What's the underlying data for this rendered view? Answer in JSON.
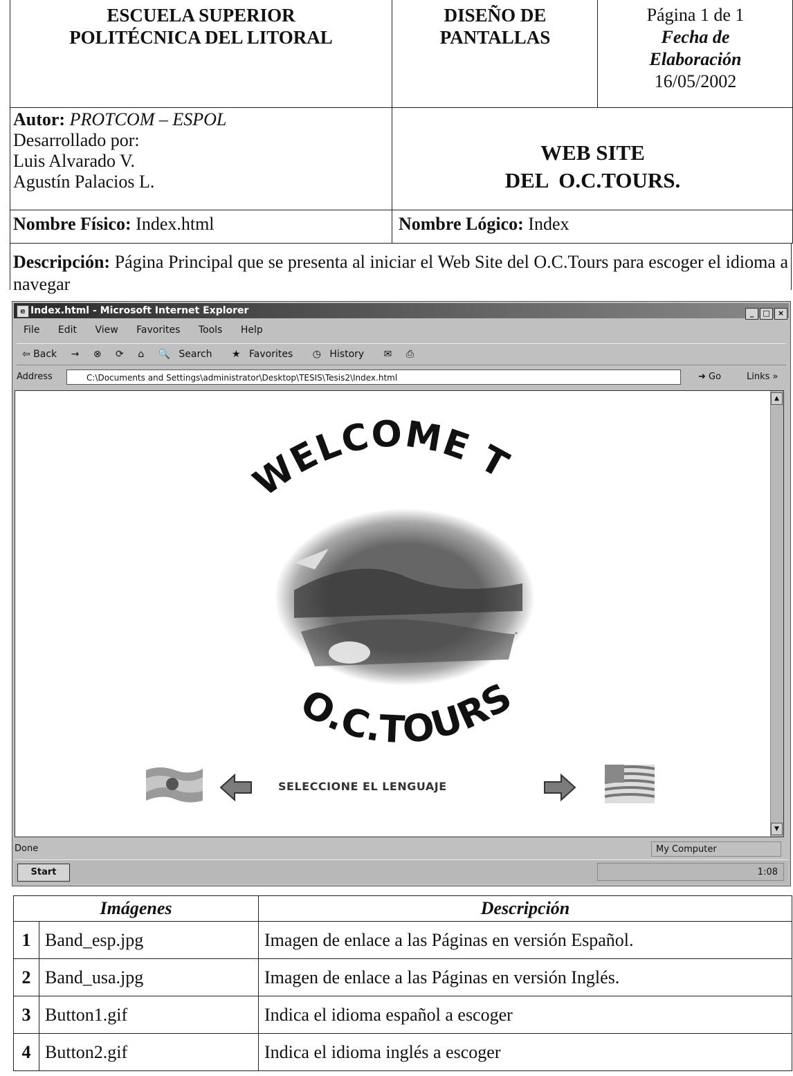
{
  "header": {
    "school": [
      "ESCUELA SUPERIOR",
      "POLITÉCNICA DEL LITORAL"
    ],
    "doc_title": [
      "DISEÑO DE",
      "PANTALLAS"
    ],
    "page": "Página 1 de 1",
    "date_label": [
      "Fecha de",
      "Elaboración"
    ],
    "date": "16/05/2002"
  },
  "author": {
    "label": "Autor:",
    "value": "PROTCOM – ESPOL",
    "dev_label": "Desarrollado por:",
    "dev1": "Luis Alvarado V.",
    "dev2": "Agustín Palacios L."
  },
  "site_title": [
    "WEB SITE",
    "DEL  O.C.TOURS."
  ],
  "names": {
    "phys_label": "Nombre Físico:",
    "phys_value": "Index.html",
    "logic_label": "Nombre Lógico:",
    "logic_value": "Index"
  },
  "description": {
    "label": "Descripción:",
    "text": "Página Principal que se presenta al iniciar el Web Site  del  O.C.Tours para escoger el idioma a navegar"
  },
  "browser": {
    "title": "Index.html - Microsoft Internet Explorer",
    "menu": [
      "File",
      "Edit",
      "View",
      "Favorites",
      "Tools",
      "Help"
    ],
    "toolbar": [
      "⇦ Back",
      "→",
      "Stop",
      "Refresh",
      "Home",
      "Search",
      "Favorites",
      "History"
    ],
    "address_label": "Address",
    "address": "C:\\Documents and Settings\\administrator\\Desktop\\TESIS\\Tesis2\\Index.html",
    "go": "Go",
    "links": "Links »",
    "status": "Done",
    "zone": "My Computer",
    "start": "Start",
    "clock": "1:08"
  },
  "page": {
    "welcome": "WELCOME TO",
    "brand": "O.C.TOURS",
    "select_language": "SELECCIONE EL LENGUAJE"
  },
  "images_table": {
    "headers": [
      "Imágenes",
      "Descripción"
    ],
    "rows": [
      {
        "n": "1",
        "file": "Band_esp.jpg",
        "desc": "Imagen de enlace a las Páginas en versión Español."
      },
      {
        "n": "2",
        "file": "Band_usa.jpg",
        "desc": "Imagen de enlace a las Páginas en versión Inglés."
      },
      {
        "n": "3",
        "file": "Button1.gif",
        "desc": "Indica el idioma español a escoger"
      },
      {
        "n": "4",
        "file": "Button2.gif",
        "desc": "Indica el idioma inglés a escoger"
      }
    ]
  }
}
